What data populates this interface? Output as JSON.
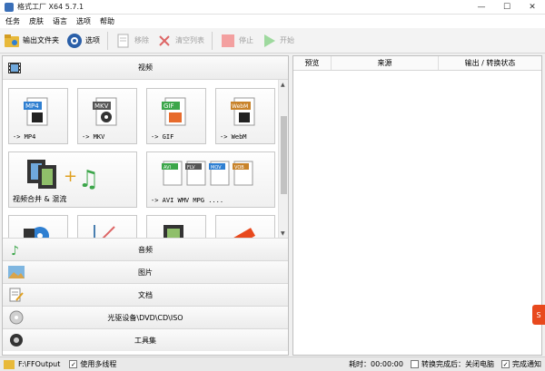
{
  "window": {
    "title": "格式工厂 X64 5.7.1",
    "min": "—",
    "max": "☐",
    "close": "✕"
  },
  "menu": [
    "任务",
    "皮肤",
    "语言",
    "选项",
    "帮助"
  ],
  "toolbar": {
    "output_folder": "输出文件夹",
    "options": "选项",
    "remove": "移除",
    "clear_list": "清空列表",
    "stop": "停止",
    "start": "开始"
  },
  "categories": {
    "video": "视频",
    "audio": "音频",
    "image": "图片",
    "document": "文档",
    "disc": "光驱设备\\DVD\\CD\\ISO",
    "toolbox": "工具集"
  },
  "video_tiles": [
    {
      "badge": "MP4",
      "label": "-> MP4",
      "color": "#2f7fd1"
    },
    {
      "badge": "MKV",
      "label": "-> MKV",
      "color": "#555555"
    },
    {
      "badge": "GIF",
      "label": "-> GIF",
      "color": "#3ca64a"
    },
    {
      "badge": "WebM",
      "label": "-> WebM",
      "color": "#c8832b"
    }
  ],
  "wide_tiles": [
    {
      "label": "视频合并 & 混流"
    },
    {
      "label": "-> AVI WMV MPG ....",
      "badges": [
        "AVI",
        "FLV",
        "MOV",
        "VOB"
      ]
    }
  ],
  "table": {
    "headers": [
      "预览",
      "来源",
      "输出 / 转换状态"
    ]
  },
  "status": {
    "output_path": "F:\\FFOutput",
    "multithread": "使用多线程",
    "elapsed": "耗时：00:00:00",
    "after_convert": "转换完成后：关闭电脑",
    "notify": "完成通知"
  },
  "colors": {
    "accent": "#2f7fd1",
    "red": "#e8491d"
  }
}
